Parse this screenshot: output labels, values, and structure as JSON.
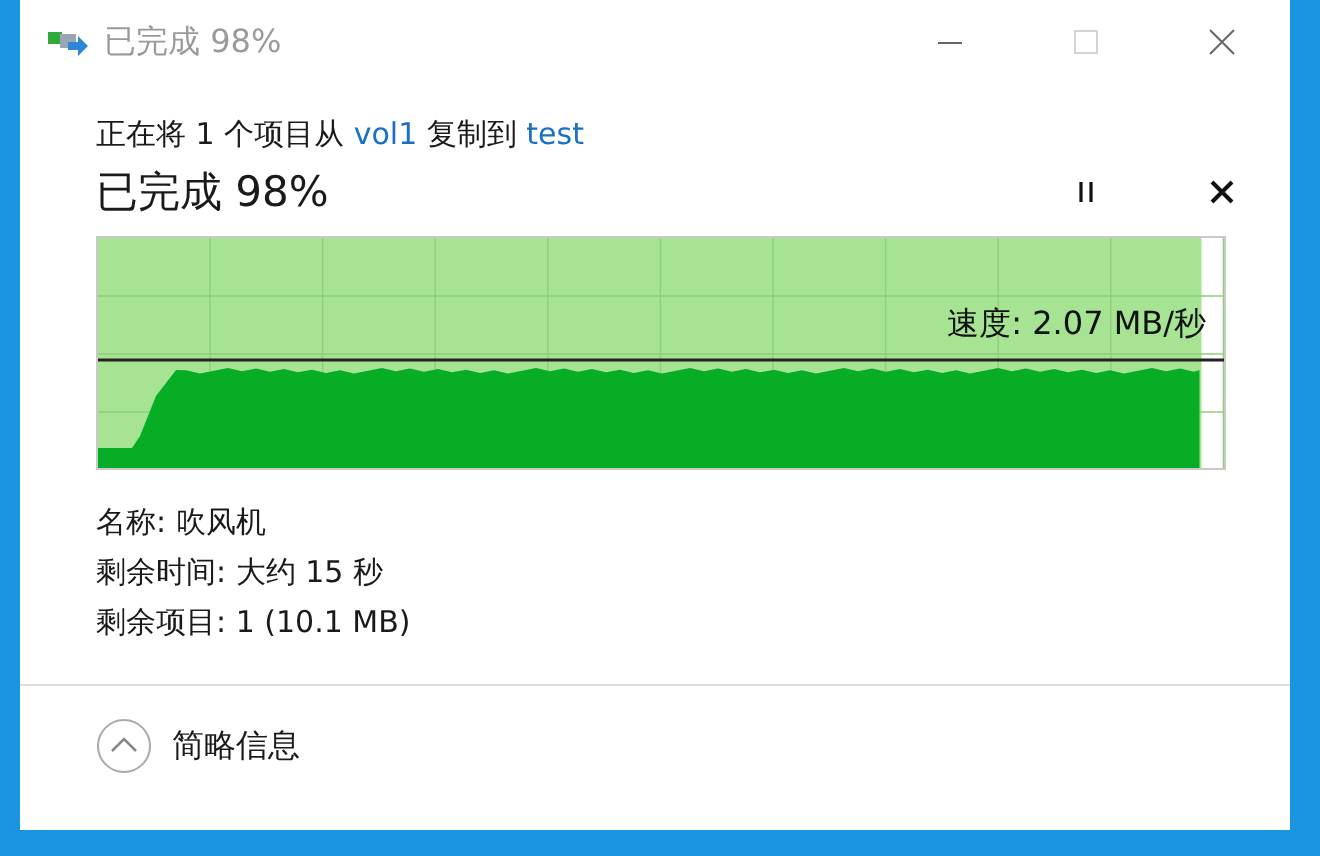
{
  "window": {
    "title": "已完成 98%"
  },
  "window_buttons": [
    {
      "kind": "minimize",
      "disabled": false
    },
    {
      "kind": "maximize",
      "disabled": true
    },
    {
      "kind": "close",
      "disabled": false
    }
  ],
  "copy_line": {
    "before": "正在将 1 个项目从",
    "source": "vol1",
    "middle": "复制到",
    "destination": "test"
  },
  "progress": {
    "heading": "已完成 98%",
    "level": 0.98,
    "speed": "速度: 2.07 MB/秒"
  },
  "details": [
    "名称: 吹风机",
    "剩余时间: 大约 15 秒",
    "剩余项目: 1 (10.1 MB)"
  ],
  "footer": {
    "toggle_label": "简略信息"
  }
}
